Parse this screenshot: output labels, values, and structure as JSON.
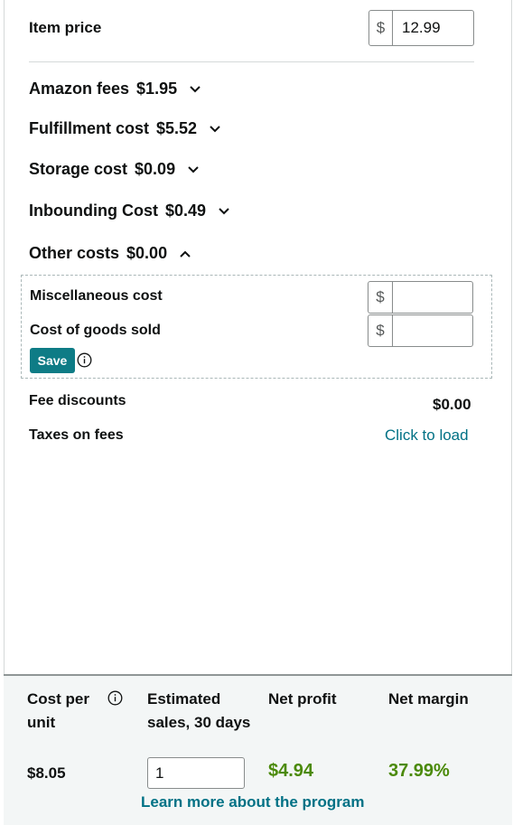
{
  "item_price": {
    "label": "Item price",
    "currency": "$",
    "value": "12.99"
  },
  "fees": [
    {
      "label": "Amazon fees",
      "amount": "$1.95",
      "expanded": false
    },
    {
      "label": "Fulfillment cost",
      "amount": "$5.52",
      "expanded": false
    },
    {
      "label": "Storage cost",
      "amount": "$0.09",
      "expanded": false
    },
    {
      "label": "Inbounding Cost",
      "amount": "$0.49",
      "expanded": false
    },
    {
      "label": "Other costs",
      "amount": "$0.00",
      "expanded": true
    }
  ],
  "other_costs": {
    "misc_label": "Miscellaneous cost",
    "cogs_label": "Cost of goods sold",
    "currency": "$",
    "save_label": "Save"
  },
  "fee_discounts": {
    "label": "Fee discounts",
    "value": "$0.00"
  },
  "taxes_on_fees": {
    "label": "Taxes on fees",
    "link": "Click to load"
  },
  "summary": {
    "cost_per_unit_label": "Cost per unit",
    "estimated_sales_label": "Estimated sales, 30 days",
    "net_profit_label": "Net profit",
    "net_margin_label": "Net margin",
    "cost_per_unit": "$8.05",
    "estimated_sales": "1",
    "net_profit": "$4.94",
    "net_margin": "37.99%",
    "learn_more": "Learn more about the program"
  },
  "colors": {
    "accent_teal": "#0e7c86",
    "link": "#007185",
    "profit_green": "#4b8a0a"
  }
}
